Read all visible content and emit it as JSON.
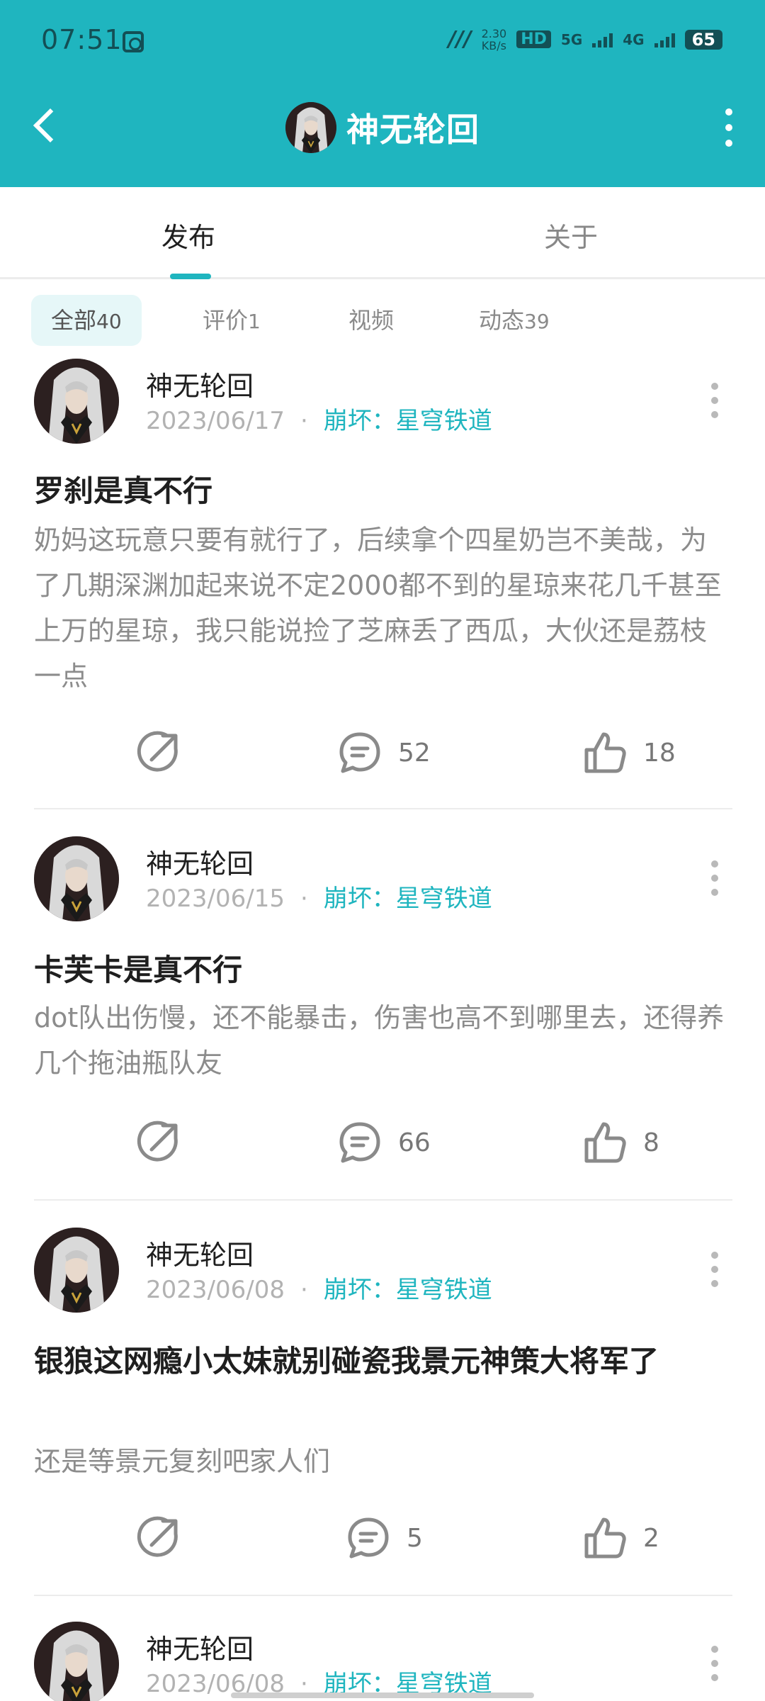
{
  "status_bar": {
    "time": "07:51",
    "network_speed": "2.30",
    "network_unit": "KB/s",
    "hd_tag": "HD",
    "signal_5g": "5G",
    "signal_4g": "4G",
    "battery": "65"
  },
  "header": {
    "title": "神无轮回",
    "back_icon": "chevron-left-icon",
    "more_icon": "more-vertical-icon"
  },
  "tabs": [
    {
      "label": "发布",
      "active": true
    },
    {
      "label": "关于",
      "active": false
    }
  ],
  "filters": [
    {
      "label": "全部",
      "count": "40",
      "active": true
    },
    {
      "label": "评价",
      "count": "1",
      "active": false
    },
    {
      "label": "视频",
      "count": "",
      "active": false
    },
    {
      "label": "动态",
      "count": "39",
      "active": false
    }
  ],
  "posts": [
    {
      "author": "神无轮回",
      "date": "2023/06/17",
      "separator": "·",
      "game": "崩坏：星穹铁道",
      "title": "罗刹是真不行",
      "body": "奶妈这玩意只要有就行了，后续拿个四星奶岂不美哉，为了几期深渊加起来说不定2000都不到的星琼来花几千甚至上万的星琼，我只能说捡了芝麻丢了西瓜，大伙还是荔枝一点",
      "comments": "52",
      "likes": "18"
    },
    {
      "author": "神无轮回",
      "date": "2023/06/15",
      "separator": "·",
      "game": "崩坏：星穹铁道",
      "title": "卡芙卡是真不行",
      "body": "dot队出伤慢，还不能暴击，伤害也高不到哪里去，还得养几个拖油瓶队友",
      "comments": "66",
      "likes": "8"
    },
    {
      "author": "神无轮回",
      "date": "2023/06/08",
      "separator": "·",
      "game": "崩坏：星穹铁道",
      "title": "银狼这网瘾小太妹就别碰瓷我景元神策大将军了",
      "body": "还是等景元复刻吧家人们",
      "comments": "5",
      "likes": "2"
    },
    {
      "author": "神无轮回",
      "date": "2023/06/08",
      "separator": "·",
      "game": "崩坏：星穹铁道"
    }
  ],
  "colors": {
    "accent": "#1fb5bf",
    "header_bg": "#1fb5bf",
    "muted_text": "#8c8c8c"
  }
}
